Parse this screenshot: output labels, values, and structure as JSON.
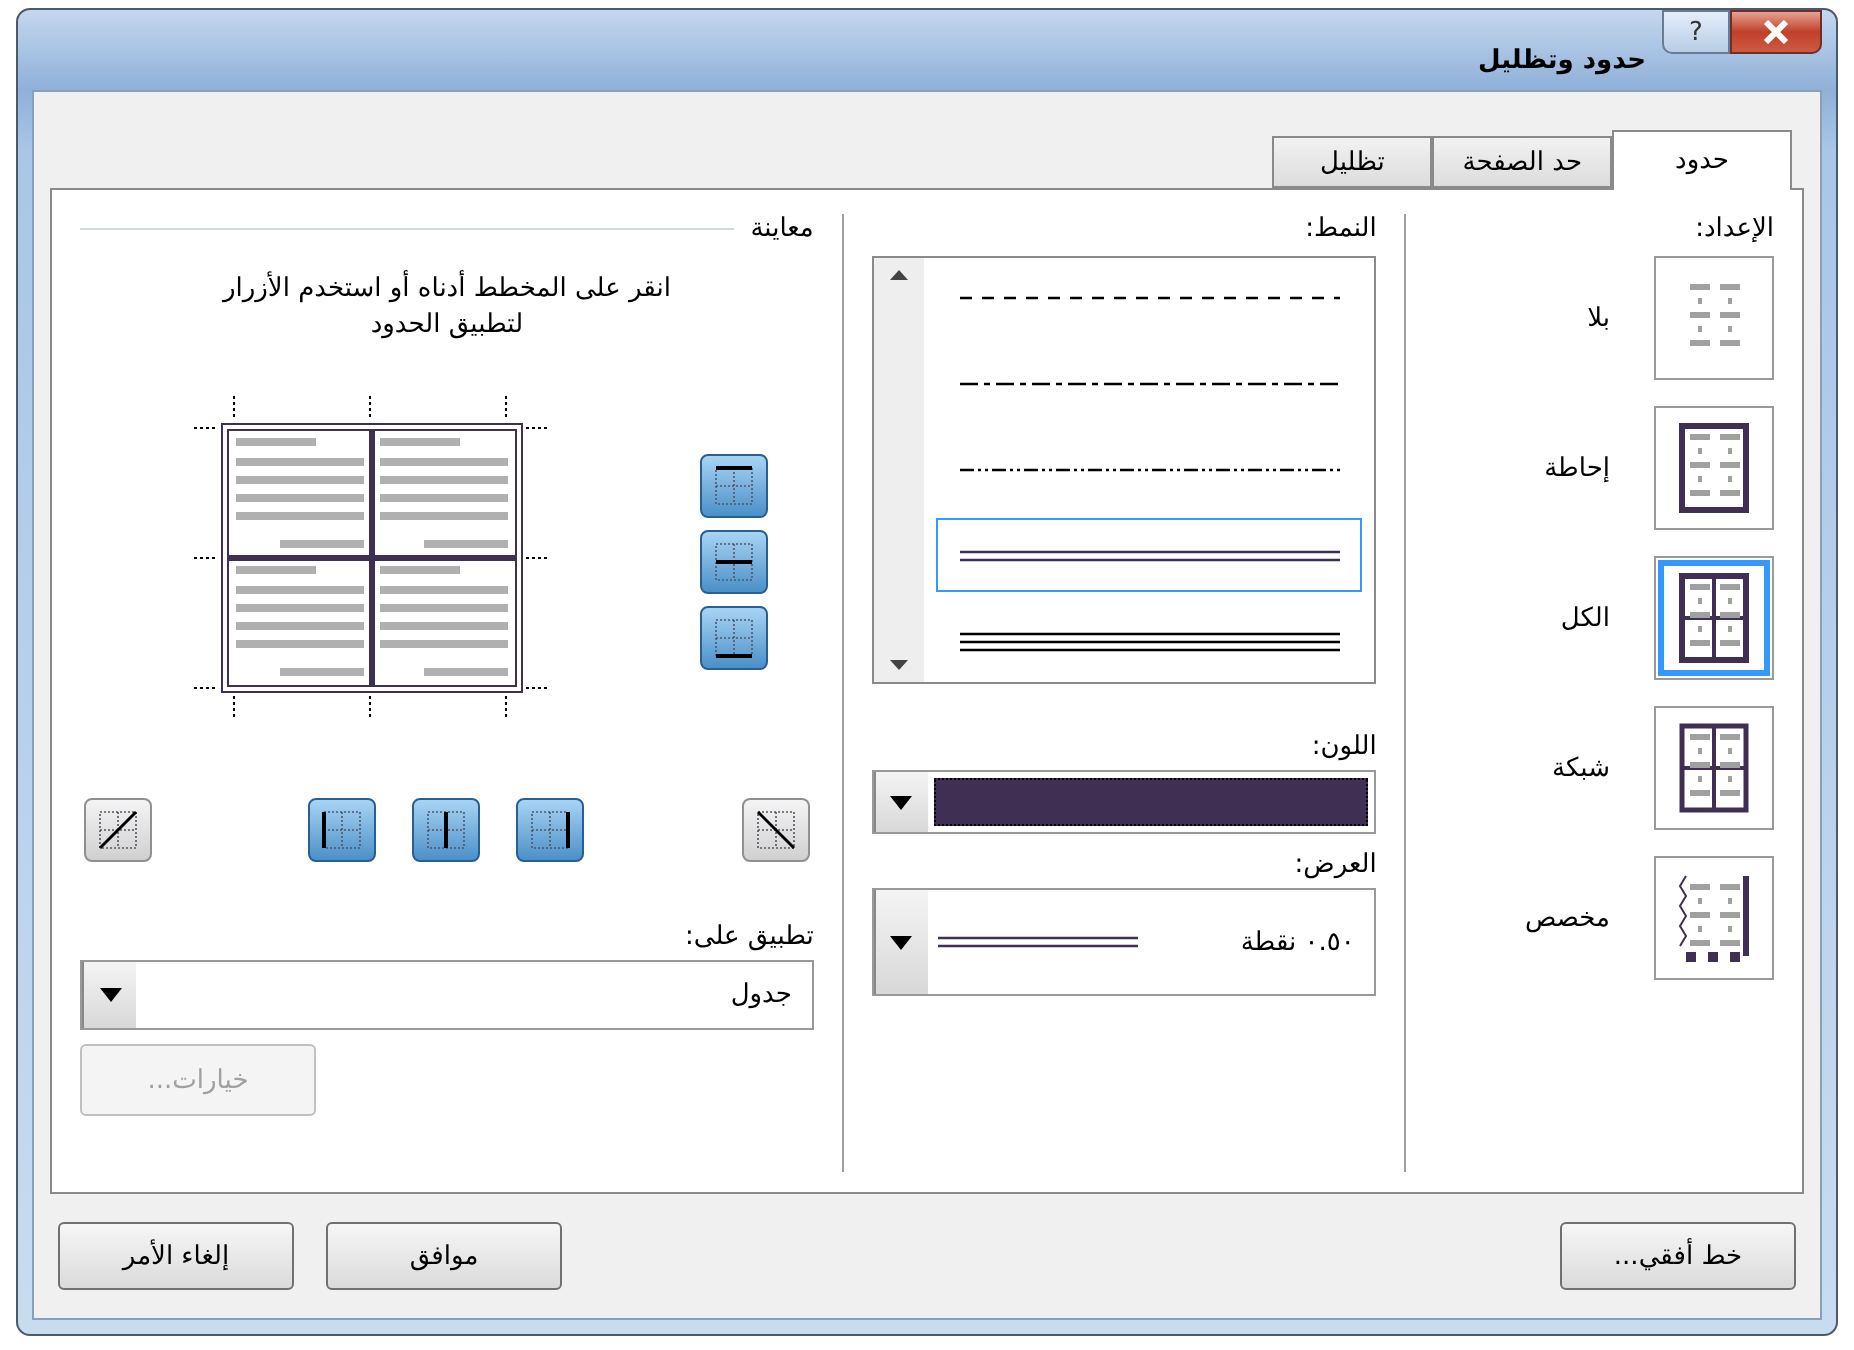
{
  "window": {
    "title": "حدود وتظليل",
    "help": "?"
  },
  "tabs": [
    {
      "label": "حدود",
      "selected": true
    },
    {
      "label": "حد الصفحة",
      "selected": false
    },
    {
      "label": "تظليل",
      "selected": false
    }
  ],
  "settings": {
    "label": "الإعداد:",
    "items": [
      {
        "kind": "none",
        "label": "بلا",
        "selected": false
      },
      {
        "kind": "box",
        "label": "إحاطة",
        "selected": false
      },
      {
        "kind": "all",
        "label": "الكل",
        "selected": true
      },
      {
        "kind": "grid",
        "label": "شبكة",
        "selected": false
      },
      {
        "kind": "custom",
        "label": "مخصص",
        "selected": false
      }
    ]
  },
  "style": {
    "label": "النمط:",
    "items": [
      {
        "kind": "dashed",
        "selected": false
      },
      {
        "kind": "dash-dot",
        "selected": false
      },
      {
        "kind": "dash-dot-dot",
        "selected": false
      },
      {
        "kind": "double",
        "selected": true
      },
      {
        "kind": "triple",
        "selected": false
      }
    ]
  },
  "color": {
    "label": "اللون:",
    "color": "#3f2f52"
  },
  "width": {
    "label": "العرض:",
    "value": "٠.٥٠ نقطة"
  },
  "preview": {
    "label": "معاينة",
    "instructions": "انقر على المخطط أدناه أو استخدم الأزرار لتطبيق الحدود",
    "side_buttons": [
      {
        "kind": "top",
        "on": true
      },
      {
        "kind": "middle",
        "on": true
      },
      {
        "kind": "bottom",
        "on": true
      }
    ],
    "bottom_buttons": [
      {
        "kind": "diag-down",
        "on": false
      },
      {
        "kind": "right",
        "on": true
      },
      {
        "kind": "center",
        "on": true
      },
      {
        "kind": "left",
        "on": true
      },
      {
        "kind": "diag-up",
        "on": false
      }
    ]
  },
  "apply_to": {
    "label": "تطبيق على:",
    "value": "جدول"
  },
  "options_button": {
    "label": "خيارات...",
    "disabled": true
  },
  "footer": {
    "horizontal_line": "خط أفقي...",
    "ok": "موافق",
    "cancel": "إلغاء الأمر"
  }
}
